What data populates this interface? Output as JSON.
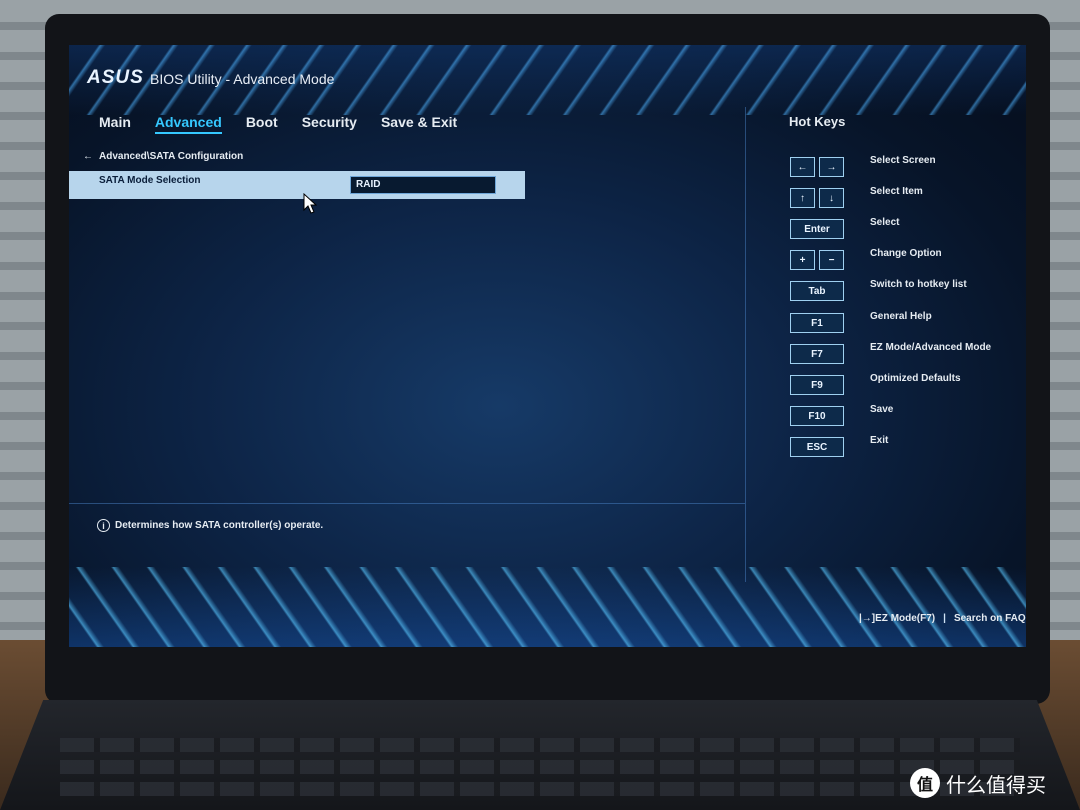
{
  "header": {
    "logo_text": "ASUS",
    "title": "BIOS Utility - Advanced Mode"
  },
  "tabs": [
    {
      "label": "Main"
    },
    {
      "label": "Advanced",
      "active": true
    },
    {
      "label": "Boot"
    },
    {
      "label": "Security"
    },
    {
      "label": "Save & Exit"
    }
  ],
  "breadcrumb": "Advanced\\SATA Configuration",
  "setting": {
    "label": "SATA Mode Selection",
    "value": "RAID"
  },
  "help_text": "Determines how SATA controller(s) operate.",
  "hotkeys": {
    "title": "Hot Keys",
    "items": [
      {
        "keys": [
          "←",
          "→"
        ],
        "label": "Select Screen"
      },
      {
        "keys": [
          "↑",
          "↓"
        ],
        "label": "Select Item"
      },
      {
        "keys": [
          "Enter"
        ],
        "label": "Select"
      },
      {
        "keys": [
          "+",
          "−"
        ],
        "label": "Change Option"
      },
      {
        "keys": [
          "Tab"
        ],
        "label": "Switch to hotkey list"
      },
      {
        "keys": [
          "F1"
        ],
        "label": "General Help"
      },
      {
        "keys": [
          "F7"
        ],
        "label": "EZ Mode/Advanced Mode"
      },
      {
        "keys": [
          "F9"
        ],
        "label": "Optimized Defaults"
      },
      {
        "keys": [
          "F10"
        ],
        "label": "Save"
      },
      {
        "keys": [
          "ESC"
        ],
        "label": "Exit"
      }
    ]
  },
  "footer": {
    "ez_mode": "EZ Mode(F7)",
    "search": "Search on FAQ"
  },
  "watermark": {
    "logo_glyph": "值",
    "text": "什么值得买"
  },
  "colors": {
    "accent": "#35c8ff",
    "selected_row": "#b7d5ec",
    "screen_bg": "#0d2446"
  }
}
